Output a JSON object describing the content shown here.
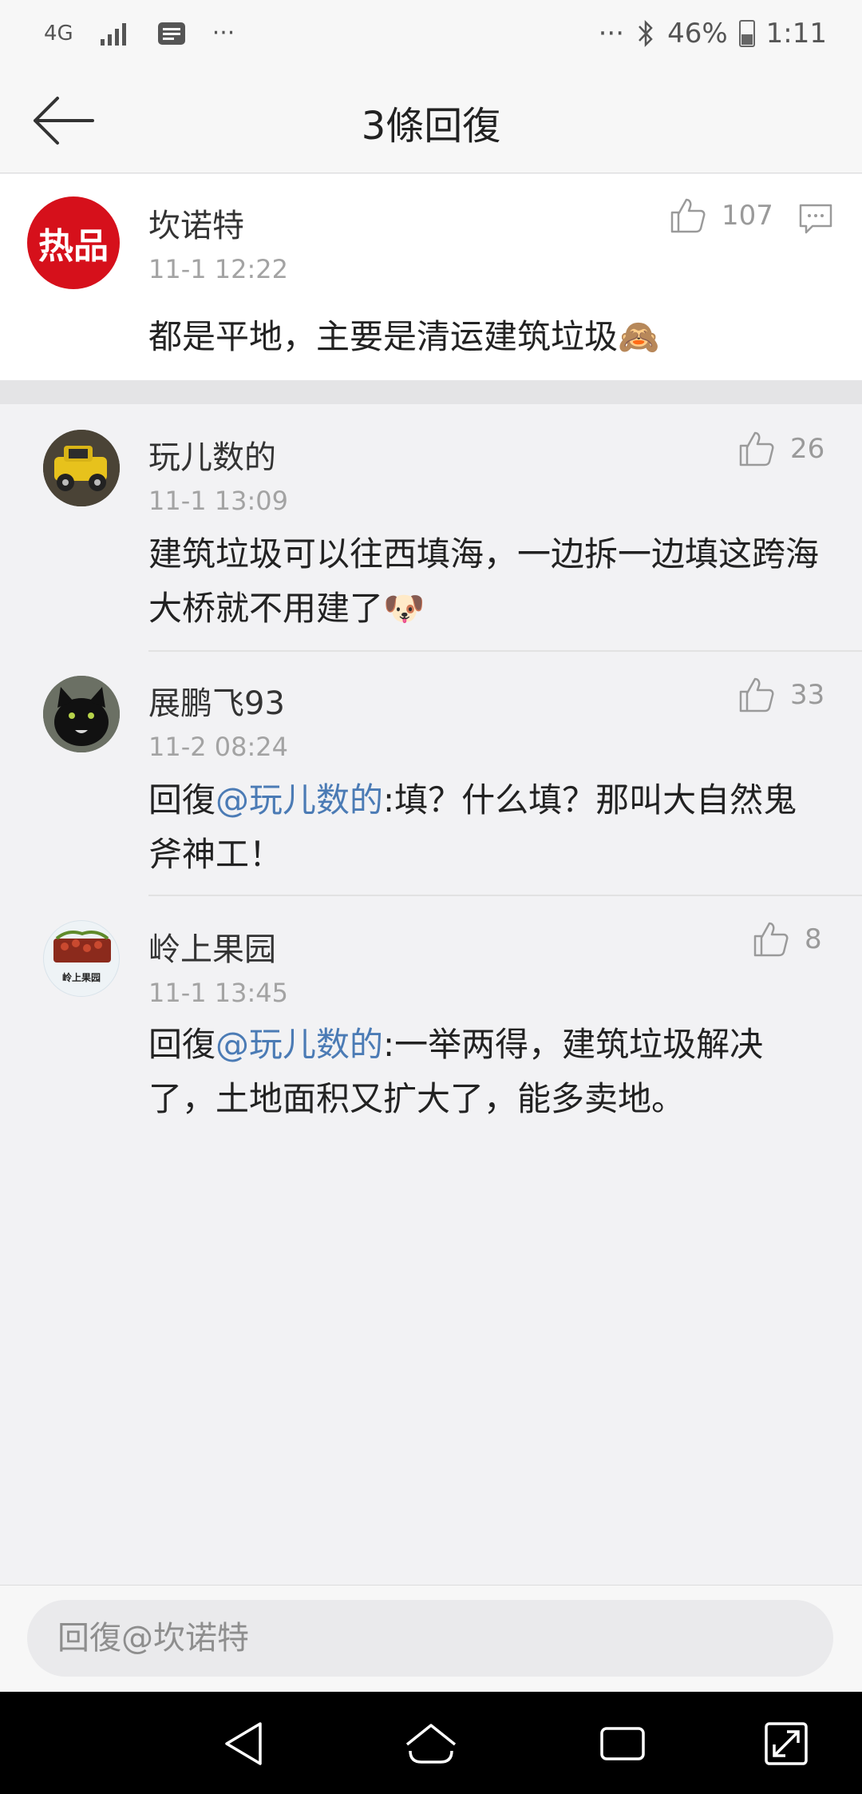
{
  "status_bar": {
    "network": "4G",
    "overflow_left": "···",
    "overflow_right": "···",
    "battery": "46%",
    "time": "1:11"
  },
  "header": {
    "title": "3條回復"
  },
  "top_comment": {
    "badge": "热品",
    "author": "坎诺特",
    "time": "11-1 12:22",
    "likes": "107",
    "text": "都是平地，主要是清运建筑垃圾🙈"
  },
  "replies": [
    {
      "author": "玩儿数的",
      "time": "11-1 13:09",
      "likes": "26",
      "text_line1": "建筑垃圾可以往西填海，一边拆一边填这跨海",
      "text_line2": "大桥就不用建了🐶"
    },
    {
      "author": "展鹏飞93",
      "time": "11-2 08:24",
      "likes": "33",
      "prefix": "回復",
      "mention": "@玩儿数的",
      "text_line1": ":填？什么填？那叫大自然鬼",
      "text_line2": "斧神工！"
    },
    {
      "author": "岭上果园",
      "time": "11-1 13:45",
      "likes": "8",
      "avatar_text": "岭上果园",
      "prefix": "回復",
      "mention": "@玩儿数的",
      "text_line1": ":一举两得，建筑垃圾解决",
      "text_line2": "了，土地面积又扩大了，能多卖地。"
    }
  ],
  "input": {
    "placeholder": "回復@坎诺特"
  },
  "colors": {
    "mention": "#4b7bb5",
    "badge": "#d6101b",
    "background": "#f2f2f4"
  }
}
